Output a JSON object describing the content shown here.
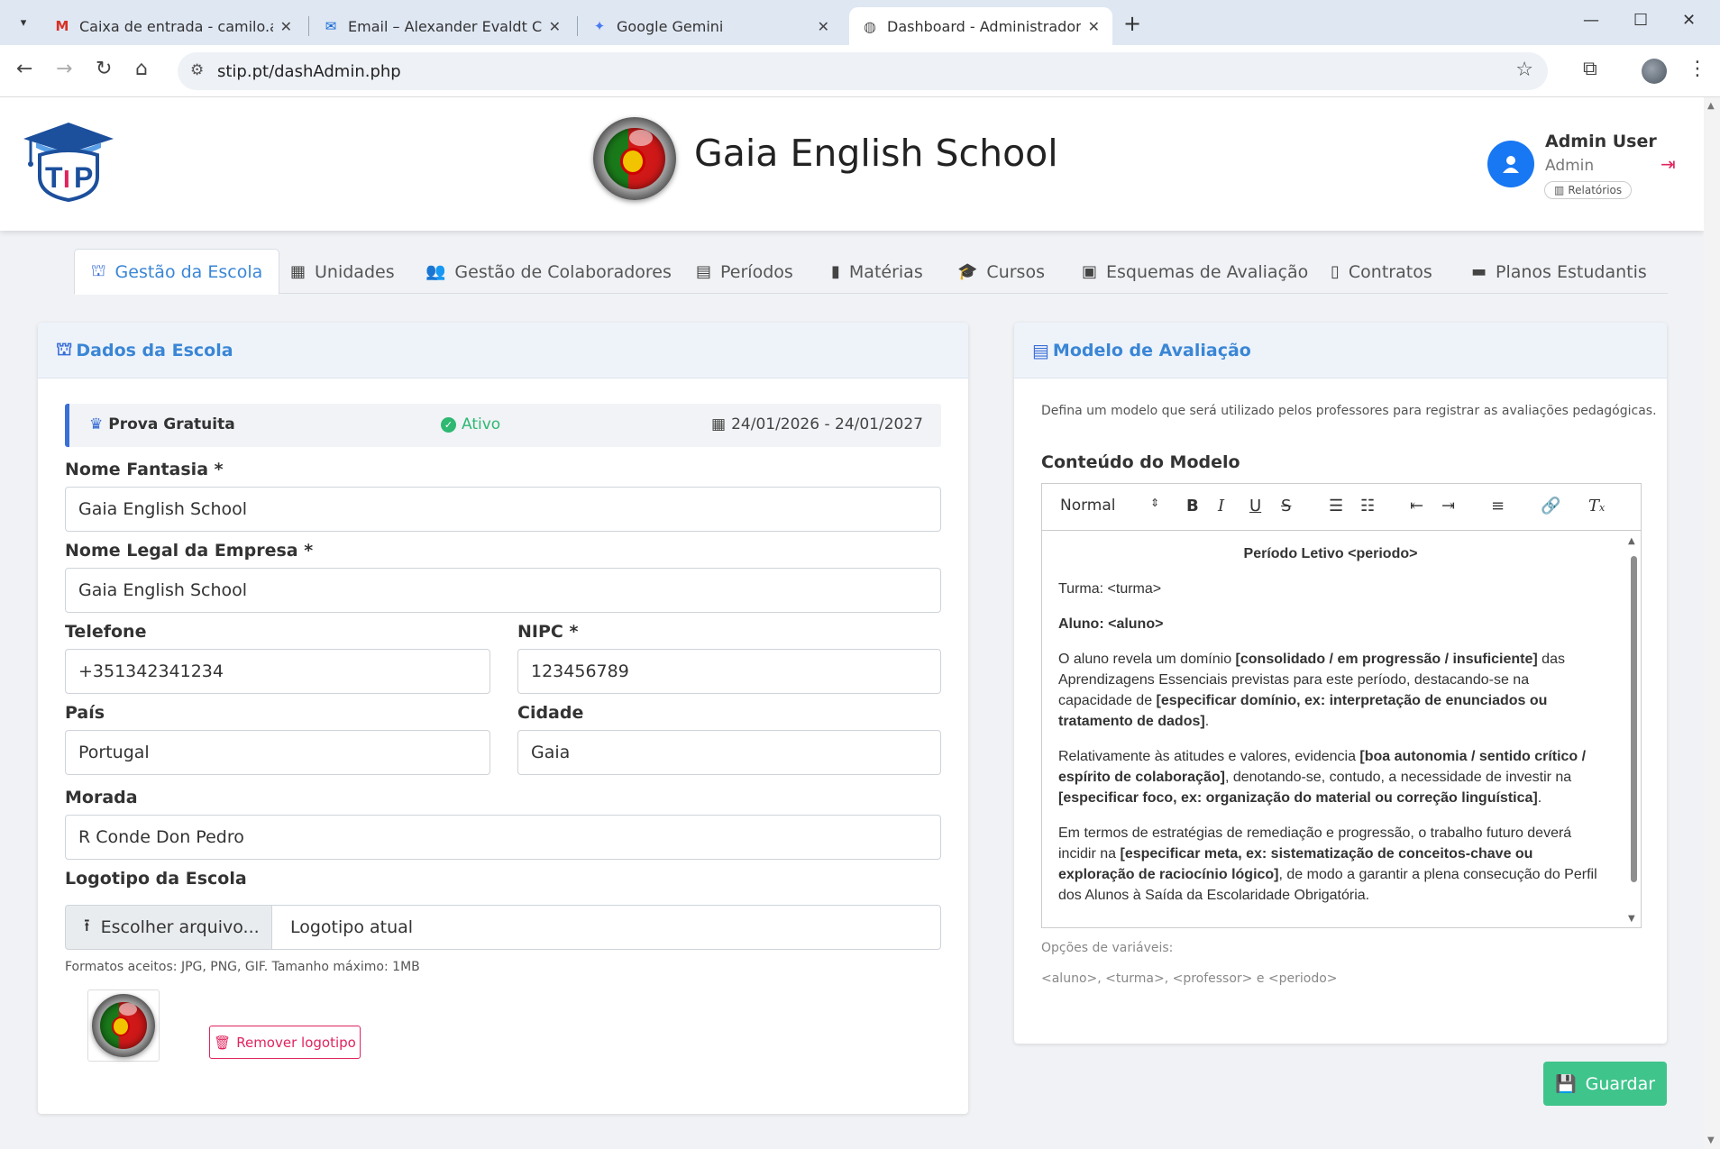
{
  "browser": {
    "tabs": [
      {
        "title": "Caixa de entrada - camilo.alexa",
        "icon": "gmail-icon"
      },
      {
        "title": "Email – Alexander Evaldt Camilo",
        "icon": "outlook-icon"
      },
      {
        "title": "Google Gemini",
        "icon": "gemini-icon"
      },
      {
        "title": "Dashboard - Administrador",
        "icon": "globe-icon",
        "active": true
      }
    ],
    "url": "stip.pt/dashAdmin.php"
  },
  "header": {
    "school_name": "Gaia English School",
    "user_name": "Admin User",
    "user_role": "Admin",
    "reports_label": "Relatórios"
  },
  "nav": {
    "tabs": [
      {
        "label": "Gestão da Escola",
        "icon": "school-icon"
      },
      {
        "label": "Unidades",
        "icon": "building-icon"
      },
      {
        "label": "Gestão de Colaboradores",
        "icon": "users-icon"
      },
      {
        "label": "Períodos",
        "icon": "calendar-icon"
      },
      {
        "label": "Matérias",
        "icon": "book-icon"
      },
      {
        "label": "Cursos",
        "icon": "graduation-cap-icon"
      },
      {
        "label": "Esquemas de Avaliação",
        "icon": "calculator-icon"
      },
      {
        "label": "Contratos",
        "icon": "file-icon"
      },
      {
        "label": "Planos Estudantis",
        "icon": "credit-card-icon"
      }
    ]
  },
  "school_card": {
    "title": "Dados da Escola",
    "plan": {
      "name": "Prova Gratuita",
      "status": "Ativo",
      "dates": "24/01/2026 - 24/01/2027"
    },
    "fields": {
      "trade_name": {
        "label": "Nome Fantasia *",
        "value": "Gaia English School"
      },
      "legal_name": {
        "label": "Nome Legal da Empresa *",
        "value": "Gaia English School"
      },
      "phone": {
        "label": "Telefone",
        "value": "+351342341234"
      },
      "nipc": {
        "label": "NIPC *",
        "value": "123456789"
      },
      "country": {
        "label": "País",
        "value": "Portugal"
      },
      "city": {
        "label": "Cidade",
        "value": "Gaia"
      },
      "address": {
        "label": "Morada",
        "value": "R Conde Don Pedro"
      }
    },
    "logo": {
      "label": "Logotipo da Escola",
      "choose_file": "Escolher arquivo...",
      "current": "Logotipo atual",
      "help": "Formatos aceitos: JPG, PNG, GIF. Tamanho máximo: 1MB",
      "remove": "Remover logotipo"
    }
  },
  "model_card": {
    "title": "Modelo de Avaliação",
    "description": "Defina um modelo que será utilizado pelos professores para registrar as avaliações pedagógicas.",
    "content_label": "Conteúdo do Modelo",
    "format_select": "Normal",
    "content": {
      "heading": "Período Letivo <periodo>",
      "class_line": "Turma: <turma>",
      "student_line": "Aluno: <aluno>",
      "p1a": "O aluno revela um domínio ",
      "p1b": "[consolidado / em progressão / insuficiente]",
      "p1c": " das Aprendizagens Essenciais previstas para este período, destacando-se na capacidade de ",
      "p1d": "[especificar domínio, ex: interpretação de enunciados ou tratamento de dados]",
      "p1e": ".",
      "p2a": "Relativamente às atitudes e valores, evidencia ",
      "p2b": "[boa autonomia / sentido crítico / espírito de colaboração]",
      "p2c": ", denotando-se, contudo, a necessidade de investir na ",
      "p2d": "[especificar foco, ex: organização do material ou correção linguística]",
      "p2e": ".",
      "p3a": "Em termos de estratégias de remediação e progressão, o trabalho futuro deverá incidir na ",
      "p3b": "[especificar meta, ex: sistematização de conceitos-chave ou exploração de raciocínio lógico]",
      "p3c": ", de modo a garantir a plena consecução do Perfil dos Alunos à Saída da Escolaridade Obrigatória."
    },
    "vars_label": "Opções de variáveis:",
    "vars_list": "<aluno>, <turma>, <professor> e <periodo>"
  },
  "save_label": "Guardar",
  "colors": {
    "primary": "#3a86d6",
    "success": "#3fc48c",
    "danger": "#e0245e"
  }
}
